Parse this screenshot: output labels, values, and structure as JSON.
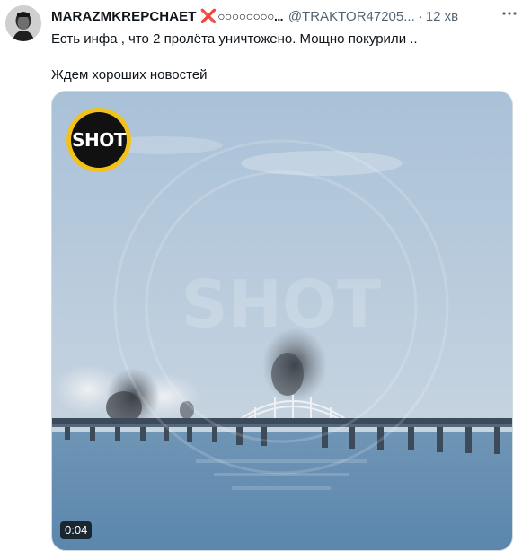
{
  "tweet": {
    "author": {
      "display_name": "MARAZMKREPCHAET",
      "name_emoji": "❌",
      "name_suffix": "○○○○○○○○...",
      "handle": "@TRAKTOR47205...",
      "separator": "·",
      "time": "12 хв"
    },
    "text_line1": "Есть инфа , что 2 пролёта уничтожено. Мощно покурили ..",
    "text_line2": "Ждем хороших новостей",
    "media": {
      "logo_text": "SHOT",
      "watermark_text": "SHOT",
      "duration": "0:04"
    }
  },
  "colors": {
    "text": "#0f1419",
    "secondary": "#536471",
    "logo_ring": "#f3c21a",
    "name_emoji": "#e0245e"
  },
  "icons": [
    "avatar",
    "more-options-icon",
    "shot-logo"
  ]
}
